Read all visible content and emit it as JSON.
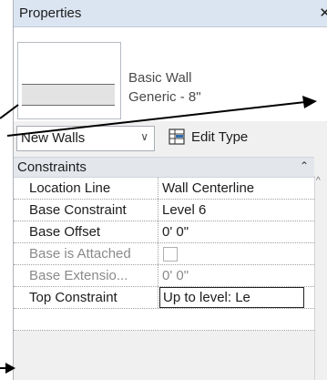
{
  "window": {
    "title": "Properties"
  },
  "type_selector": {
    "family": "Basic Wall",
    "type": "Generic - 8\""
  },
  "instance_selector": {
    "value": "New Walls",
    "edit_type_label": "Edit Type"
  },
  "group": {
    "label": "Constraints"
  },
  "properties": [
    {
      "name": "Location Line",
      "value": "Wall Centerline",
      "state": "normal"
    },
    {
      "name": "Base Constraint",
      "value": "Level 6",
      "state": "normal"
    },
    {
      "name": "Base Offset",
      "value": "0'  0\"",
      "state": "normal"
    },
    {
      "name": "Base is Attached",
      "value": "",
      "state": "disabled",
      "kind": "checkbox"
    },
    {
      "name": "Base Extensio...",
      "value": "0'  0\"",
      "state": "disabled"
    },
    {
      "name": "Top Constraint",
      "value": "Up to level: Le",
      "state": "editing"
    }
  ],
  "icons": {
    "close": "close-icon",
    "dropdown": "chevron-down-icon",
    "edit_type": "edit-type-icon",
    "collapse": "collapse-icon",
    "scroll_up": "scroll-up-icon",
    "arrows": "arrow-icon"
  },
  "colors": {
    "title_bar": "#dbe5f2",
    "panel": "#f0f0f0",
    "group_header": "#e3e7ec",
    "disabled_text": "#8a8a8a"
  }
}
